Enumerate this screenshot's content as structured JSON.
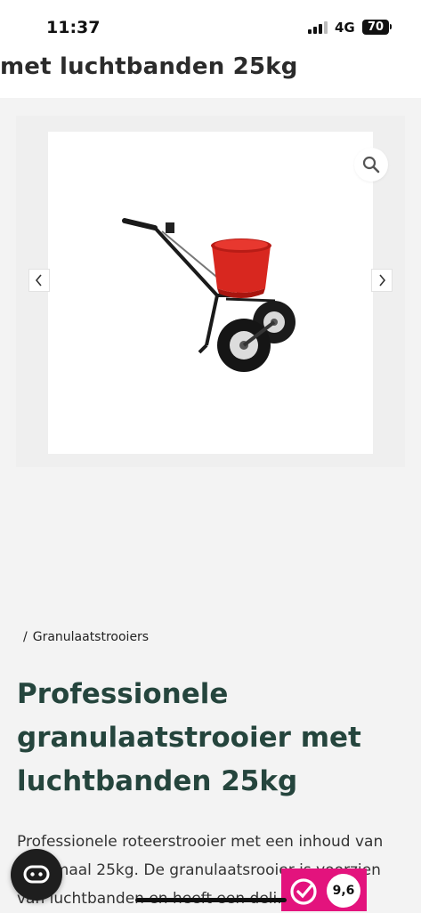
{
  "status_bar": {
    "time": "11:37",
    "network": "4G",
    "battery": "70"
  },
  "sticky_header": {
    "title_fragment": "met luchtbanden 25kg"
  },
  "gallery": {
    "zoom_icon": "magnifier-icon",
    "prev_icon": "chevron-left-icon",
    "next_icon": "chevron-right-icon",
    "image_subject": "red broadcast spreader with air tyres"
  },
  "breadcrumb": {
    "separator": "/",
    "category": "Granulaatstrooiers"
  },
  "product": {
    "title_lines": [
      "Professionele",
      "granulaatstrooier met",
      "luchtbanden 25kg"
    ],
    "description_lines": [
      "Professionele roteerstrooier met een inhoud van",
      "maximaal 25kg. De granulaatsrooier is voorzien",
      "van luchtbanden en heeft een deli..."
    ]
  },
  "chat": {
    "icon": "chat-icon"
  },
  "reviews": {
    "score": "9,6",
    "brand_color": "#e3137d"
  },
  "colors": {
    "title": "#25453d",
    "hopper_red": "#d8271f",
    "page_bg": "#f3f3f3"
  }
}
